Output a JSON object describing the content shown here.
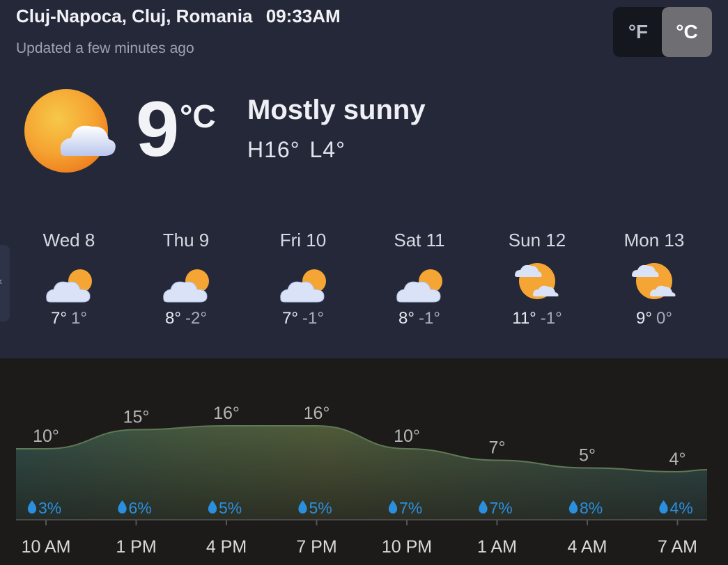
{
  "header": {
    "location": "Cluj-Napoca, Cluj, Romania",
    "time": "09:33AM",
    "updated": "Updated a few minutes ago"
  },
  "units": {
    "fahrenheit": "°F",
    "celsius": "°C",
    "selected": "celsius"
  },
  "current": {
    "temp": "9",
    "unit": "°C",
    "condition": "Mostly sunny",
    "high": "H16°",
    "low": "L4°",
    "icon": "sun-behind-cloud-icon"
  },
  "daily": [
    {
      "day": "Wed 8",
      "high": "7°",
      "low": "1°",
      "icon": "partly-cloudy-icon"
    },
    {
      "day": "Thu 9",
      "high": "8°",
      "low": "-2°",
      "icon": "partly-cloudy-icon"
    },
    {
      "day": "Fri 10",
      "high": "7°",
      "low": "-1°",
      "icon": "partly-cloudy-icon"
    },
    {
      "day": "Sat 11",
      "high": "8°",
      "low": "-1°",
      "icon": "partly-cloudy-icon"
    },
    {
      "day": "Sun 12",
      "high": "11°",
      "low": "-1°",
      "icon": "mostly-sunny-icon"
    },
    {
      "day": "Mon 13",
      "high": "9°",
      "low": "0°",
      "icon": "mostly-sunny-icon"
    }
  ],
  "chart_data": {
    "type": "area",
    "x": [
      "10 AM",
      "1 PM",
      "4 PM",
      "7 PM",
      "10 PM",
      "1 AM",
      "4 AM",
      "7 AM"
    ],
    "temperature_labels": [
      "10°",
      "15°",
      "16°",
      "16°",
      "10°",
      "7°",
      "5°",
      "4°"
    ],
    "temperature": [
      10,
      15,
      16,
      16,
      10,
      7,
      5,
      4
    ],
    "precipitation": [
      "3%",
      "6%",
      "5%",
      "5%",
      "7%",
      "7%",
      "8%",
      "4%"
    ],
    "precipitation_values": [
      3,
      6,
      5,
      5,
      7,
      7,
      8,
      4
    ],
    "colors": {
      "line": "#5f7856",
      "precip": "#2b8fe0",
      "label": "#b6b6b6",
      "axis": "#d9d9d9"
    }
  }
}
